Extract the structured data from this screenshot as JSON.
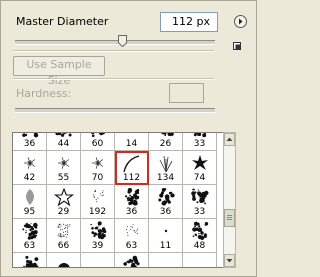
{
  "brush_panel": {
    "master_diameter_label": "Master Diameter",
    "master_diameter_value": "112 px",
    "use_sample_size_label": "Use Sample Size",
    "hardness_label": "Hardness:",
    "hardness_value": ""
  },
  "icons": {
    "menu": "right-arrow-circle-icon",
    "new_preset": "new-preset-icon"
  },
  "colors": {
    "selection": "#e0231b",
    "panel_bg": "#ece9d8"
  },
  "presets": [
    {
      "label": "36",
      "shape": "splatter"
    },
    {
      "label": "44",
      "shape": "splatter"
    },
    {
      "label": "60",
      "shape": "splatter"
    },
    {
      "label": "14",
      "shape": "dots"
    },
    {
      "label": "26",
      "shape": "splatter"
    },
    {
      "label": "33",
      "shape": "splatter"
    },
    {
      "label": "42",
      "shape": "star-burst"
    },
    {
      "label": "55",
      "shape": "star-burst"
    },
    {
      "label": "70",
      "shape": "star-burst"
    },
    {
      "label": "112",
      "shape": "curve"
    },
    {
      "label": "134",
      "shape": "grass"
    },
    {
      "label": "74",
      "shape": "leaf-star"
    },
    {
      "label": "95",
      "shape": "leaf"
    },
    {
      "label": "29",
      "shape": "star"
    },
    {
      "label": "192",
      "shape": "dots"
    },
    {
      "label": "36",
      "shape": "splatter"
    },
    {
      "label": "36",
      "shape": "splatter"
    },
    {
      "label": "33",
      "shape": "splatter"
    },
    {
      "label": "63",
      "shape": "splatter"
    },
    {
      "label": "66",
      "shape": "dense-dots"
    },
    {
      "label": "39",
      "shape": "splatter"
    },
    {
      "label": "63",
      "shape": "dots"
    },
    {
      "label": "11",
      "shape": "dot"
    },
    {
      "label": "48",
      "shape": "splatter"
    },
    {
      "label": "",
      "shape": "splatter"
    },
    {
      "label": "",
      "shape": "round"
    },
    {
      "label": "",
      "shape": "none"
    },
    {
      "label": "",
      "shape": "splatter"
    },
    {
      "label": "",
      "shape": "none"
    },
    {
      "label": "",
      "shape": "none"
    }
  ],
  "selected_label": "112"
}
